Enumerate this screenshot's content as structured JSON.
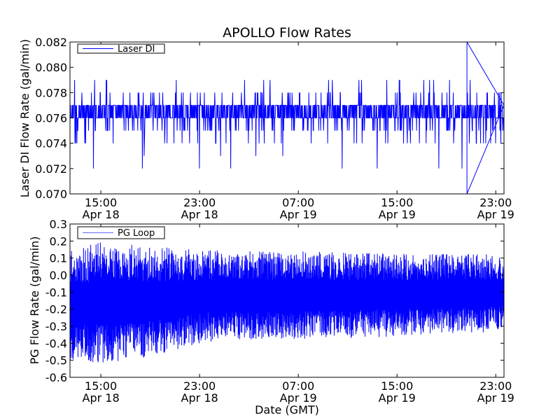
{
  "title": "APOLLO Flow Rates",
  "xlabel": "Date (GMT)",
  "x_tick_labels": [
    {
      "time": "15:00",
      "date": "Apr 18"
    },
    {
      "time": "23:00",
      "date": "Apr 18"
    },
    {
      "time": "07:00",
      "date": "Apr 19"
    },
    {
      "time": "15:00",
      "date": "Apr 19"
    },
    {
      "time": "23:00",
      "date": "Apr 19"
    }
  ],
  "chart_data": [
    {
      "type": "line",
      "ylabel": "Laser DI Flow Rate (gal/min)",
      "x_range": [
        "Apr 18 12:30",
        "Apr 19 23:40"
      ],
      "x_ticks": [
        "Apr 18 15:00",
        "Apr 18 23:00",
        "Apr 19 07:00",
        "Apr 19 15:00",
        "Apr 19 23:00"
      ],
      "ylim": [
        0.07,
        0.082
      ],
      "y_ticks": [
        "0.070",
        "0.072",
        "0.074",
        "0.076",
        "0.078",
        "0.080",
        "0.082"
      ],
      "legend": {
        "placement": "top-left",
        "entries": [
          "Laser DI"
        ]
      },
      "series": [
        {
          "name": "Laser DI",
          "color": "#0000ff",
          "baseline_band": [
            0.076,
            0.077
          ],
          "typical_range": [
            0.074,
            0.079
          ],
          "occasional_dips": [
            0.073,
            0.072
          ],
          "extremes": [
            {
              "x": "Apr 19 20:40",
              "y": 0.082
            },
            {
              "x": "Apr 19 20:40",
              "y": 0.07
            }
          ]
        }
      ]
    },
    {
      "type": "line",
      "ylabel": "PG Flow Rate (gal/min)",
      "x_range": [
        "Apr 18 12:30",
        "Apr 19 23:40"
      ],
      "x_ticks": [
        "Apr 18 15:00",
        "Apr 18 23:00",
        "Apr 19 07:00",
        "Apr 19 15:00",
        "Apr 19 23:00"
      ],
      "ylim": [
        -0.6,
        0.3
      ],
      "y_ticks": [
        "-0.6",
        "-0.5",
        "-0.4",
        "-0.3",
        "-0.2",
        "-0.1",
        "0.0",
        "0.1",
        "0.2",
        "0.3"
      ],
      "legend": {
        "placement": "top-left",
        "entries": [
          "PG Loop"
        ]
      },
      "series": [
        {
          "name": "PG Loop",
          "color": "#0000ff",
          "envelope": [
            {
              "x": "Apr 18 12:30",
              "min": -0.5,
              "max": 0.15
            },
            {
              "x": "Apr 18 15:00",
              "min": -0.52,
              "max": 0.2
            },
            {
              "x": "Apr 18 19:00",
              "min": -0.48,
              "max": 0.17
            },
            {
              "x": "Apr 18 23:00",
              "min": -0.4,
              "max": 0.15
            },
            {
              "x": "Apr 19 03:00",
              "min": -0.38,
              "max": 0.14
            },
            {
              "x": "Apr 19 07:00",
              "min": -0.38,
              "max": 0.14
            },
            {
              "x": "Apr 19 15:00",
              "min": -0.36,
              "max": 0.13
            },
            {
              "x": "Apr 19 23:40",
              "min": -0.33,
              "max": 0.12
            }
          ],
          "center": -0.13
        }
      ]
    }
  ]
}
